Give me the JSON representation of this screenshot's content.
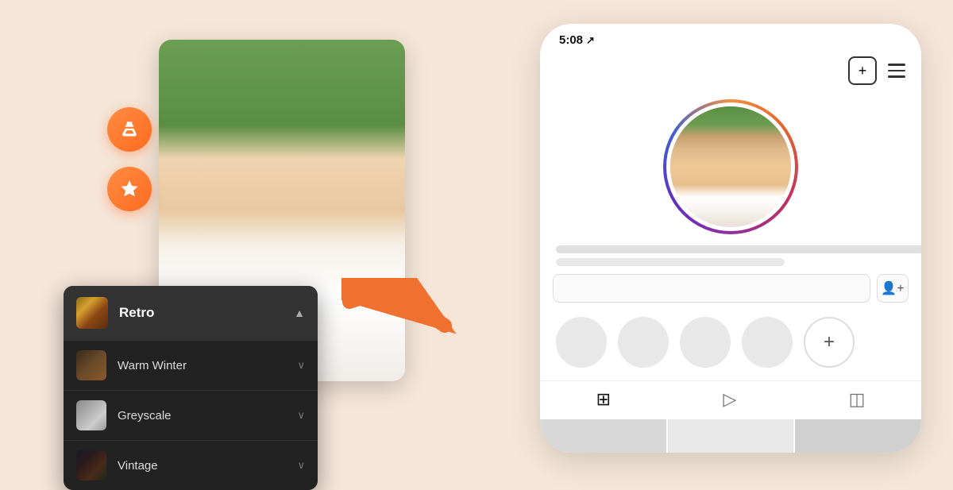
{
  "background_color": "#f5e6d8",
  "left_section": {
    "tool_buttons": [
      {
        "id": "flask-btn",
        "icon": "flask",
        "label": "Flask Tool"
      },
      {
        "id": "star-btn",
        "icon": "star",
        "label": "Favorites"
      }
    ],
    "dropdown": {
      "header": {
        "label": "Retro",
        "chevron": "▲"
      },
      "items": [
        {
          "id": "warm-winter",
          "label": "Warm Winter",
          "chevron": "∨"
        },
        {
          "id": "greyscale",
          "label": "Greyscale",
          "chevron": "∨"
        },
        {
          "id": "vintage",
          "label": "Vintage",
          "chevron": "∨"
        }
      ]
    }
  },
  "phone": {
    "status_bar": {
      "time": "5:08",
      "nav_icon": "↗"
    },
    "header_icons": {
      "add": "+",
      "menu": "≡"
    },
    "story_circles": [
      "",
      "",
      "",
      ""
    ],
    "add_circle_label": "+",
    "tabs": [
      {
        "id": "grid-tab",
        "icon": "⊞",
        "active": true
      },
      {
        "id": "play-tab",
        "icon": "▷",
        "active": false
      },
      {
        "id": "tag-tab",
        "icon": "◫",
        "active": false
      }
    ]
  }
}
